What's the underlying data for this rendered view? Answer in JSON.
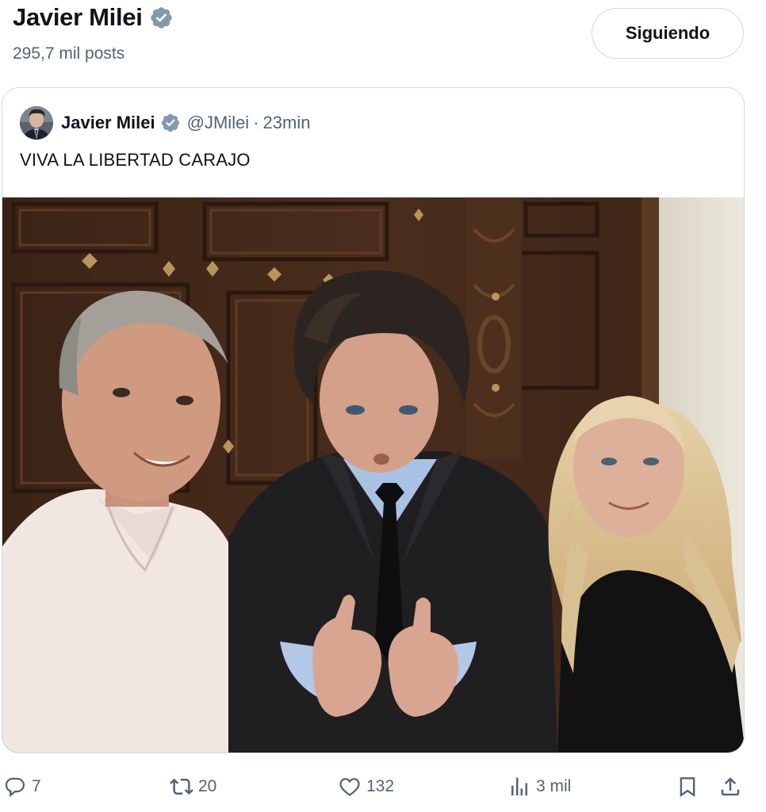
{
  "header": {
    "name": "Javier Milei",
    "posts_count": "295,7 mil posts",
    "follow_label": "Siguiendo"
  },
  "quote": {
    "author": "Javier Milei",
    "handle": "@JMilei",
    "separator": "·",
    "time": "23min",
    "text": "VIVA LA LIBERTAD CARAJO"
  },
  "actions": {
    "replies": "7",
    "reposts": "20",
    "likes": "132",
    "views": "3 mil"
  },
  "icons": {
    "verified": "verified-badge-icon",
    "reply": "reply-icon",
    "repost": "repost-icon",
    "like": "heart-icon",
    "views": "views-icon",
    "bookmark": "bookmark-icon",
    "share": "share-icon"
  },
  "colors": {
    "verified": "#829aab",
    "text_primary": "#0f1419",
    "text_secondary": "#536471",
    "border": "#cfd9de"
  }
}
